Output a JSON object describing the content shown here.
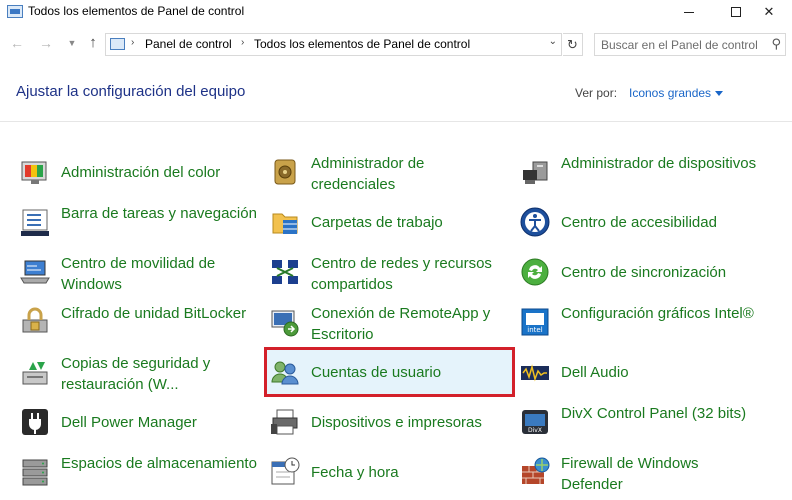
{
  "window": {
    "title": "Todos los elementos de Panel de control"
  },
  "navigation": {
    "breadcrumbs": [
      "Panel de control",
      "Todos los elementos de Panel de control"
    ],
    "search_placeholder": "Buscar en el Panel de control"
  },
  "header": {
    "title": "Ajustar la configuración del equipo",
    "view_by_label": "Ver por:",
    "view_by_value": "Iconos grandes"
  },
  "items": [
    {
      "label": "Administración del color",
      "icon": "color-management-icon"
    },
    {
      "label": "Administrador de credenciales",
      "icon": "credential-manager-icon"
    },
    {
      "label": "Administrador de dispositivos",
      "icon": "device-manager-icon"
    },
    {
      "label": "Barra de tareas y navegación",
      "icon": "taskbar-icon"
    },
    {
      "label": "Carpetas de trabajo",
      "icon": "work-folders-icon"
    },
    {
      "label": "Centro de accesibilidad",
      "icon": "accessibility-icon"
    },
    {
      "label": "Centro de movilidad de Windows",
      "icon": "mobility-center-icon"
    },
    {
      "label": "Centro de redes y recursos compartidos",
      "icon": "network-center-icon"
    },
    {
      "label": "Centro de sincronización",
      "icon": "sync-center-icon"
    },
    {
      "label": "Cifrado de unidad BitLocker",
      "icon": "bitlocker-icon"
    },
    {
      "label": "Conexión de RemoteApp y Escritorio",
      "icon": "remoteapp-icon"
    },
    {
      "label": "Configuración gráficos Intel®",
      "icon": "intel-graphics-icon"
    },
    {
      "label": "Copias de seguridad y restauración (W...",
      "icon": "backup-restore-icon"
    },
    {
      "label": "Cuentas de usuario",
      "icon": "user-accounts-icon"
    },
    {
      "label": "Dell Audio",
      "icon": "dell-audio-icon"
    },
    {
      "label": "Dell Power Manager",
      "icon": "dell-power-icon"
    },
    {
      "label": "Dispositivos e impresoras",
      "icon": "devices-printers-icon"
    },
    {
      "label": "DivX Control Panel (32 bits)",
      "icon": "divx-icon"
    },
    {
      "label": "Espacios de almacenamiento",
      "icon": "storage-spaces-icon"
    },
    {
      "label": "Fecha y hora",
      "icon": "date-time-icon"
    },
    {
      "label": "Firewall de Windows Defender",
      "icon": "firewall-icon"
    }
  ]
}
